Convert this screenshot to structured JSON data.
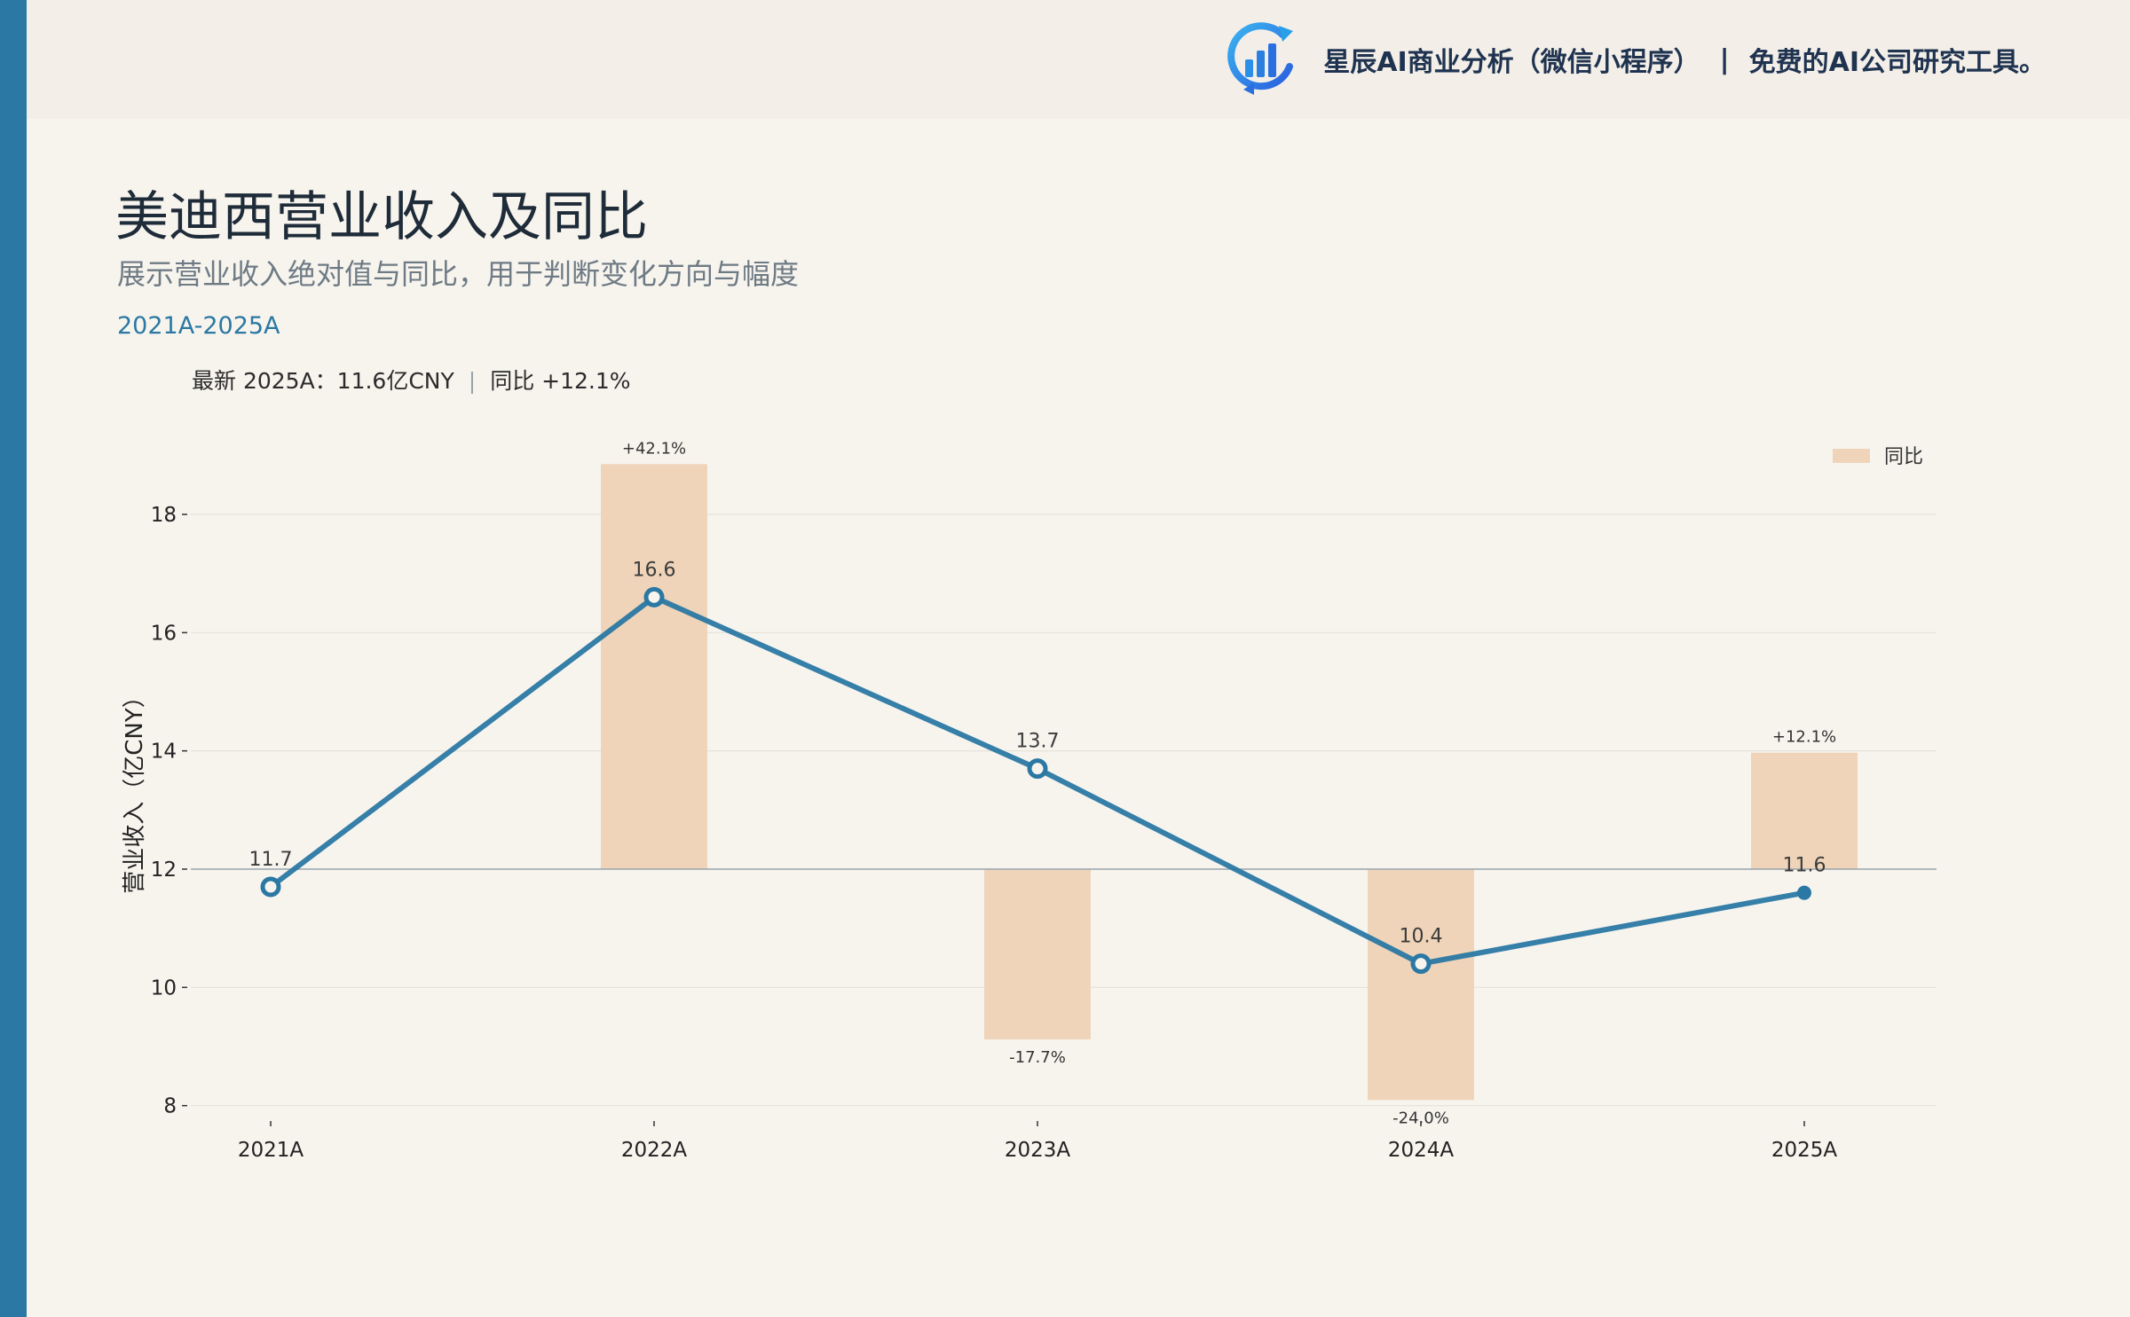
{
  "brand": {
    "name": "星辰AI商业分析（微信小程序）",
    "separator": "|",
    "slogan": "免费的AI公司研究工具。",
    "logo_icon": "bar-chart-refresh-icon",
    "accent_color": "#2a78a3"
  },
  "header": {
    "title": "美迪西营业收入及同比",
    "subtitle": "展示营业收入绝对值与同比，用于判断变化方向与幅度",
    "range": "2021A-2025A"
  },
  "summary": {
    "latest": "最新 2025A：11.6亿CNY",
    "separator": "|",
    "yoy": "同比 +12.1%"
  },
  "chart_data": {
    "type": "line",
    "categories": [
      "2021A",
      "2022A",
      "2023A",
      "2024A",
      "2025A"
    ],
    "series": [
      {
        "type": "line",
        "values": [
          11.7,
          16.6,
          13.7,
          10.4,
          11.6
        ],
        "labels": [
          "11.7",
          "16.6",
          "13.7",
          "10.4",
          "11.6"
        ],
        "color": "#2a78a3"
      },
      {
        "type": "bar",
        "name": "同比",
        "values": [
          null,
          42.1,
          -17.7,
          -24.0,
          12.1
        ],
        "labels": [
          "",
          "+42.1%",
          "-17.7%",
          "-24.0%",
          "+12.1%"
        ],
        "color": "#efd4b9"
      }
    ],
    "ylabel": "营业收入（亿CNY）",
    "ylim": [
      7.8,
      19.2
    ],
    "yticks": [
      8,
      10,
      12,
      14,
      16,
      18
    ],
    "ytick_labels": [
      "8",
      "10",
      "12",
      "14",
      "16",
      "18"
    ],
    "bar_baseline": 12,
    "bar_max_height_units": 6.85,
    "grid": true,
    "legend": "top-right"
  }
}
